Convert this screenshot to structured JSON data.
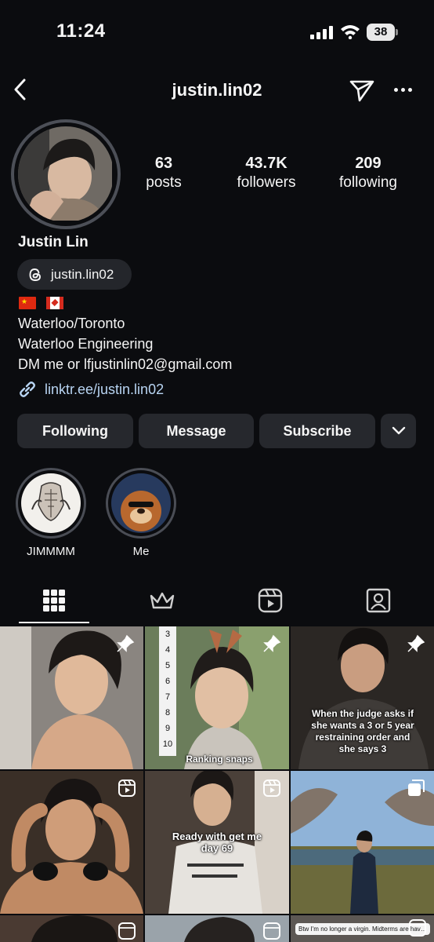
{
  "status_bar": {
    "time": "11:24",
    "battery": "38"
  },
  "header": {
    "username": "justin.lin02"
  },
  "profile": {
    "display_name": "Justin Lin",
    "threads_handle": "justin.lin02",
    "bio_lines": [
      "Waterloo/Toronto",
      "Waterloo Engineering",
      "DM me or lfjustinlin02@gmail.com"
    ],
    "link": "linktr.ee/justin.lin02",
    "flags": [
      "flag-china",
      "flag-canada"
    ]
  },
  "stats": {
    "posts": {
      "value": "63",
      "label": "posts"
    },
    "followers": {
      "value": "43.7K",
      "label": "followers"
    },
    "following": {
      "value": "209",
      "label": "following"
    }
  },
  "actions": {
    "following": "Following",
    "message": "Message",
    "subscribe": "Subscribe"
  },
  "highlights": [
    {
      "label": "JIMMMM"
    },
    {
      "label": "Me"
    }
  ],
  "tabs": [
    "grid-icon",
    "crown-icon",
    "reels-icon",
    "tagged-icon"
  ],
  "posts": [
    {
      "badge": "pin-icon",
      "caption": ""
    },
    {
      "badge": "pin-icon",
      "caption": "Ranking snaps",
      "list_numbers": [
        "3",
        "4",
        "5",
        "6",
        "7",
        "8",
        "9",
        "10"
      ]
    },
    {
      "badge": "pin-icon",
      "caption": "When the judge asks if she wants a 3 or 5 year restraining order and she says 3"
    },
    {
      "badge": "reel-icon",
      "caption": ""
    },
    {
      "badge": "reel-icon",
      "caption": "Ready with get me day 69"
    },
    {
      "badge": "multi-icon",
      "caption": ""
    },
    {
      "badge": "reel-icon",
      "caption": ""
    },
    {
      "badge": "reel-icon",
      "caption": ""
    },
    {
      "badge": "reel-icon",
      "caption": "Btw I'm no longer a virgin. Midterms are having way with me"
    }
  ],
  "colors": {
    "background": "#0b0c0f",
    "button": "#26282d",
    "link": "#b8d4f2"
  }
}
